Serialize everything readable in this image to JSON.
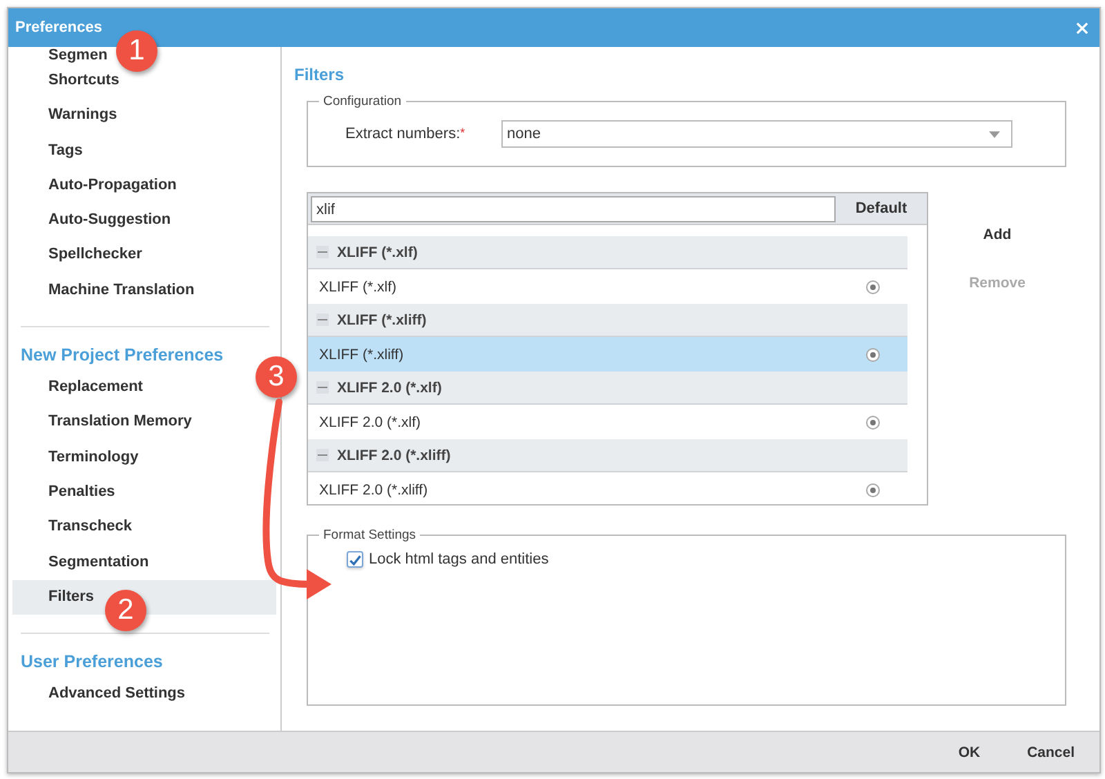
{
  "window": {
    "title": "Preferences"
  },
  "sidebar": {
    "sections": [
      {
        "items": [
          {
            "label": "Segmen",
            "selected": false
          },
          {
            "label": "Shortcuts",
            "selected": false
          },
          {
            "label": "Warnings",
            "selected": false
          },
          {
            "label": "Tags",
            "selected": false
          },
          {
            "label": "Auto-Propagation",
            "selected": false
          },
          {
            "label": "Auto-Suggestion",
            "selected": false
          },
          {
            "label": "Spellchecker",
            "selected": false
          },
          {
            "label": "Machine Translation",
            "selected": false
          }
        ]
      },
      {
        "heading": "New Project Preferences",
        "items": [
          {
            "label": "Replacement",
            "selected": false
          },
          {
            "label": "Translation Memory",
            "selected": false
          },
          {
            "label": "Terminology",
            "selected": false
          },
          {
            "label": "Penalties",
            "selected": false
          },
          {
            "label": "Transcheck",
            "selected": false
          },
          {
            "label": "Segmentation",
            "selected": false
          },
          {
            "label": "Filters",
            "selected": true
          }
        ]
      },
      {
        "heading": "User Preferences",
        "items": [
          {
            "label": "Advanced Settings",
            "selected": false
          }
        ]
      }
    ]
  },
  "content": {
    "title": "Filters",
    "configuration": {
      "legend": "Configuration",
      "label": "Extract numbers:",
      "required_mark": "*",
      "value": "none"
    },
    "filter_list": {
      "search_value": "xlif",
      "default_header": "Default",
      "rows": [
        {
          "kind": "group",
          "label": "XLIFF (*.xlf)"
        },
        {
          "kind": "item",
          "label": "XLIFF (*.xlf)",
          "selected": false,
          "default": true
        },
        {
          "kind": "group",
          "label": "XLIFF (*.xliff)"
        },
        {
          "kind": "item",
          "label": "XLIFF (*.xliff)",
          "selected": true,
          "default": true
        },
        {
          "kind": "group",
          "label": "XLIFF 2.0 (*.xlf)"
        },
        {
          "kind": "item",
          "label": "XLIFF 2.0 (*.xlf)",
          "selected": false,
          "default": true
        },
        {
          "kind": "group",
          "label": "XLIFF 2.0 (*.xliff)"
        },
        {
          "kind": "item",
          "label": "XLIFF 2.0 (*.xliff)",
          "selected": false,
          "default": true
        }
      ]
    },
    "actions": [
      {
        "label": "Add",
        "disabled": false
      },
      {
        "label": "Remove",
        "disabled": true
      }
    ],
    "format_settings": {
      "legend": "Format Settings",
      "options": [
        {
          "label": "Lock html tags and entities",
          "checked": true
        }
      ]
    }
  },
  "buttons": [
    "OK",
    "Cancel"
  ],
  "annotations": [
    "1",
    "2",
    "3"
  ]
}
